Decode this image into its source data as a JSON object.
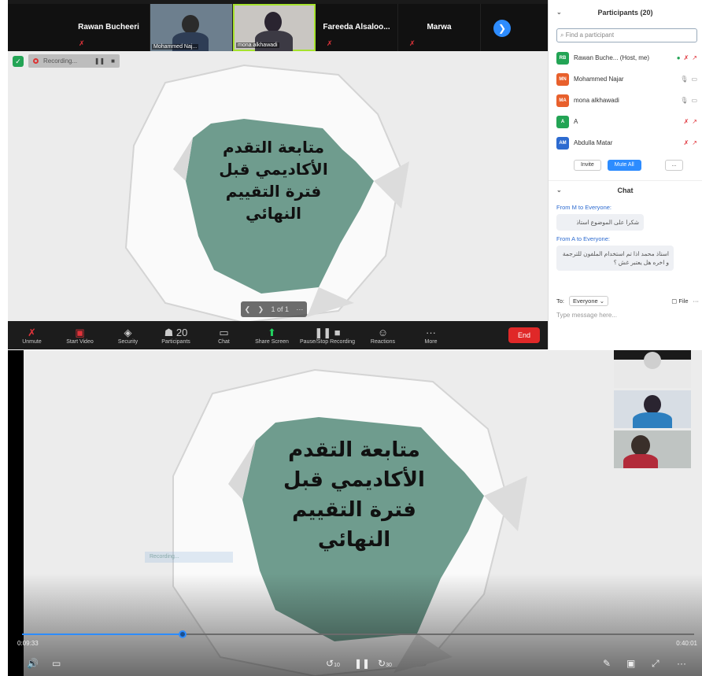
{
  "zoom": {
    "gallery": [
      {
        "name": "Rawan Bucheeri",
        "type": "name"
      },
      {
        "name": "Mohammed Naj...",
        "type": "video"
      },
      {
        "name": "mona alkhawadi",
        "type": "video-active"
      },
      {
        "name": "Fareeda Alsaloo...",
        "type": "name"
      },
      {
        "name": "Marwa",
        "type": "name"
      }
    ],
    "recording_label": "Recording...",
    "pager": "1 of 1",
    "toolbar": [
      {
        "label": "Unmute",
        "icon": "mic-off-icon",
        "glyph": "✗"
      },
      {
        "label": "Start Video",
        "icon": "video-off-icon",
        "glyph": "▣"
      },
      {
        "label": "Security",
        "icon": "shield-icon",
        "glyph": "◈"
      },
      {
        "label": "Participants",
        "icon": "participants-icon",
        "glyph": "☗ 20"
      },
      {
        "label": "Chat",
        "icon": "chat-icon",
        "glyph": "▭"
      },
      {
        "label": "Share Screen",
        "icon": "share-screen-icon",
        "glyph": "⬆"
      },
      {
        "label": "Pause/Stop Recording",
        "icon": "pause-recording-icon",
        "glyph": "❚❚ ■"
      },
      {
        "label": "Reactions",
        "icon": "reactions-icon",
        "glyph": "☺"
      },
      {
        "label": "More",
        "icon": "more-icon",
        "glyph": "···"
      }
    ],
    "end_label": "End"
  },
  "participants": {
    "title": "Participants (20)",
    "search_placeholder": "Find a participant",
    "list": [
      {
        "initials": "RB",
        "color": "#23a455",
        "name": "Rawan Buche... (Host, me)"
      },
      {
        "initials": "MN",
        "color": "#e8602c",
        "name": "Mohammed Najar"
      },
      {
        "initials": "MA",
        "color": "#e8602c",
        "name": "mona alkhawadi"
      },
      {
        "initials": "A",
        "color": "#23a455",
        "name": "A"
      },
      {
        "initials": "AM",
        "color": "#2d6bd0",
        "name": "Abdulla Matar"
      }
    ],
    "buttons": {
      "invite": "Invite",
      "mute_all": "Mute All",
      "more": "..."
    }
  },
  "chat": {
    "title": "Chat",
    "messages": [
      {
        "from": "From M to Everyone:",
        "text": "شكرا على الموضوع استاذ"
      },
      {
        "from": "From A to Everyone:",
        "text": "استاذ محمد اذا تم استخدام الملفون للترجمة و اخره هل يعتبر غش ؟"
      }
    ],
    "to_label": "To:",
    "to_value": "Everyone",
    "file_label": "File",
    "input_placeholder": "Type message here..."
  },
  "slide": {
    "lines": [
      "متابعة التقدم",
      "الأكاديمي قبل",
      "فترة التقييم",
      "النهائي"
    ],
    "panel_color": "#6f9c8e"
  },
  "player": {
    "current_time": "0:09:33",
    "total_time": "0:40:01",
    "progress": 0.2386,
    "ghost_label": "Recording...",
    "controls": {
      "volume": "volume-icon",
      "captions": "captions-icon",
      "rewind": "10",
      "play_pause": "pause-icon",
      "forward": "30",
      "pen": "pen-icon",
      "miniplayer": "miniplayer-icon",
      "fullscreen": "fullscreen-icon",
      "more": "more-icon"
    }
  }
}
